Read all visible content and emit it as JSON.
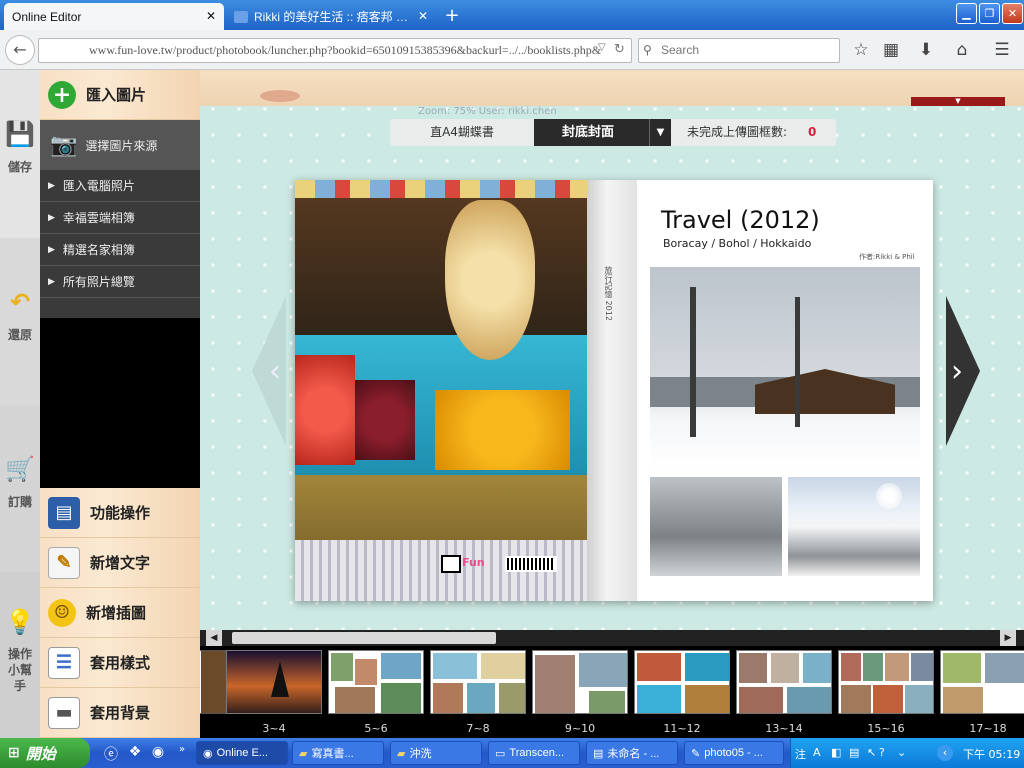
{
  "browser": {
    "tabs": [
      {
        "label": "Online Editor",
        "close": "✕"
      },
      {
        "label": "Rikki 的美好生活 :: 痞客邦 …",
        "close": "✕"
      }
    ],
    "new_tab": "+",
    "url": "www.fun-love.tw/product/photobook/luncher.php?bookid=65010915385396&backurl=../../booklists.php&",
    "search_placeholder": "Search"
  },
  "left_toolbar": [
    {
      "label": "儲存",
      "icon": "save-icon"
    },
    {
      "label": "還原",
      "icon": "undo-icon"
    },
    {
      "label": "訂購",
      "icon": "cart-icon"
    },
    {
      "label": "操作小幫手",
      "icon": "lightbulb-icon"
    }
  ],
  "sidebar": {
    "import_label": "匯入圖片",
    "source_label": "選擇圖片來源",
    "sources": [
      "匯入電腦照片",
      "幸福雲端相簿",
      "精選名家相簿",
      "所有照片總覽"
    ],
    "tools": [
      {
        "label": "功能操作",
        "icon": "printer-icon"
      },
      {
        "label": "新增文字",
        "icon": "edit-text-icon"
      },
      {
        "label": "新增插圖",
        "icon": "smiley-icon"
      },
      {
        "label": "套用樣式",
        "icon": "layout-icon"
      },
      {
        "label": "套用背景",
        "icon": "background-icon"
      }
    ]
  },
  "editor": {
    "zoom_text": "Zoom: 75%   User: rikki.chen",
    "page_size": "直A4蝴蝶書",
    "current_view": "封底封面",
    "unfinished_label": "未完成上傳圖框數:",
    "unfinished_count": "0",
    "prev_arrow": "‹",
    "next_arrow": "›"
  },
  "book": {
    "title": "Travel (2012)",
    "subtitle": "Boracay / Bohol / Hokkaido",
    "author": "作者:Rikki & Phil",
    "spine_text": "旅行記憶  2012"
  },
  "thumbnails": [
    {
      "label": "3~4"
    },
    {
      "label": "5~6"
    },
    {
      "label": "7~8"
    },
    {
      "label": "9~10"
    },
    {
      "label": "11~12"
    },
    {
      "label": "13~14"
    },
    {
      "label": "15~16"
    },
    {
      "label": "17~18"
    }
  ],
  "taskbar": {
    "start": "開始",
    "tasks": [
      "Online E...",
      "寫真書...",
      "沖洗",
      "Transcen...",
      "未命名 - ...",
      "photo05 - ..."
    ],
    "clock": "下午 05:19"
  }
}
